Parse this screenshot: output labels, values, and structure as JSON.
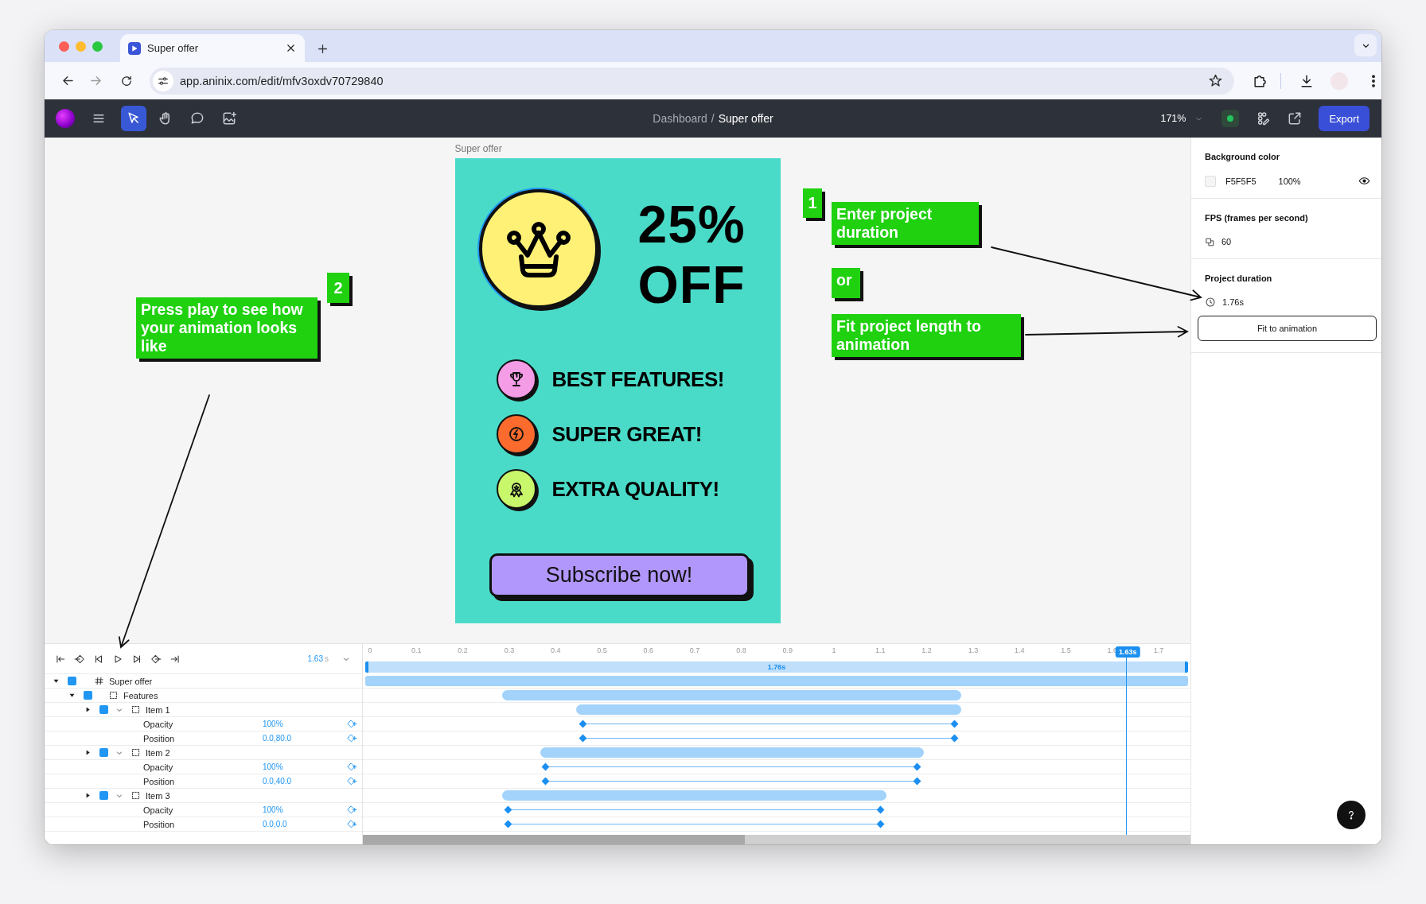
{
  "browser": {
    "tab": {
      "title": "Super offer"
    },
    "url": "app.aninix.com/edit/mfv3oxdv70729840"
  },
  "toolbar": {
    "tools": [
      {
        "kind": "select",
        "selected": true
      },
      {
        "kind": "hand",
        "selected": false
      },
      {
        "kind": "comment",
        "selected": false
      },
      {
        "kind": "image",
        "selected": false
      }
    ],
    "breadcrumb": {
      "parent": "Dashboard",
      "separator": "/",
      "current": "Super offer"
    },
    "zoom": "171%",
    "export": "Export"
  },
  "canvas": {
    "artboard_label": "Super offer",
    "artboard": {
      "headline": [
        "25%",
        "OFF"
      ],
      "features": [
        {
          "text": "BEST FEATURES!",
          "color": "#f59ce6",
          "kind": "trophy"
        },
        {
          "text": "SUPER GREAT!",
          "color": "#fb6b2d",
          "kind": "bolt"
        },
        {
          "text": "EXTRA QUALITY!",
          "color": "#c9f76b",
          "kind": "award"
        }
      ],
      "cta": "Subscribe now!"
    },
    "annotations": [
      {
        "kind": "badge",
        "text": "2"
      },
      {
        "kind": "note",
        "text": "Press play to see how your animation looks like"
      },
      {
        "kind": "badge",
        "text": "1"
      },
      {
        "kind": "note",
        "text": "Enter project duration"
      },
      {
        "kind": "note",
        "text": "or"
      },
      {
        "kind": "note",
        "text": "Fit project length to animation"
      }
    ]
  },
  "timeline": {
    "time": "1.63",
    "time_unit": "s",
    "ticks": [
      "0",
      "0.1",
      "0.2",
      "0.3",
      "0.4",
      "0.5",
      "0.6",
      "0.7",
      "0.8",
      "0.9",
      "1",
      "1.1",
      "1.2",
      "1.3",
      "1.4",
      "1.5",
      "1.6",
      "1.7"
    ],
    "duration": "1.76s",
    "playhead": "1.63s",
    "layers": [
      {
        "name": "Super offer",
        "kind": "frame",
        "expanded": true,
        "children": [
          {
            "name": "Features",
            "kind": "group",
            "expanded": true,
            "children": [
              {
                "name": "Item 1",
                "kind": "group",
                "expanded": false,
                "properties_open": true,
                "properties": [
                  {
                    "name": "Opacity",
                    "value": "100%"
                  },
                  {
                    "name": "Position",
                    "value": "0.0,80.0"
                  }
                ]
              },
              {
                "name": "Item 2",
                "kind": "group",
                "expanded": false,
                "properties_open": true,
                "properties": [
                  {
                    "name": "Opacity",
                    "value": "100%"
                  },
                  {
                    "name": "Position",
                    "value": "0.0,40.0"
                  }
                ]
              },
              {
                "name": "Item 3",
                "kind": "group",
                "expanded": false,
                "properties_open": true,
                "properties": [
                  {
                    "name": "Opacity",
                    "value": "100%"
                  },
                  {
                    "name": "Position",
                    "value": "0.0,0.0"
                  }
                ]
              }
            ]
          }
        ]
      }
    ]
  },
  "panel": {
    "background": {
      "label": "Background color",
      "hex": "F5F5F5",
      "opacity": "100%",
      "visible": true
    },
    "fps": {
      "label": "FPS (frames per second)",
      "value": "60"
    },
    "duration": {
      "label": "Project duration",
      "value": "1.76s",
      "button": "Fit to animation"
    }
  }
}
